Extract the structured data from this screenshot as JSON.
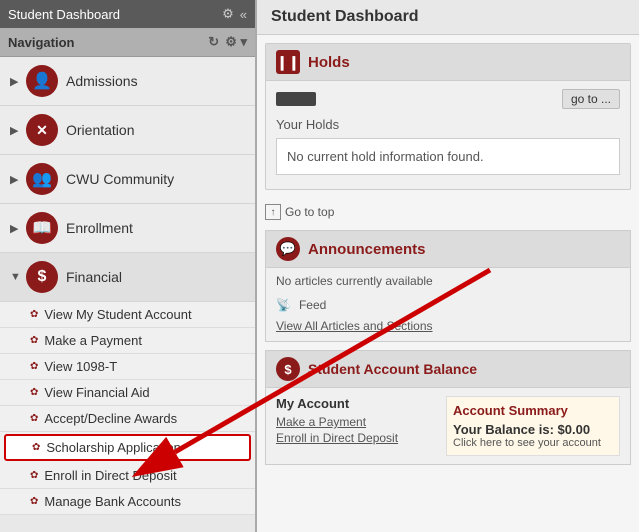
{
  "leftPanel": {
    "title": "Student Dashboard",
    "navLabel": "Navigation",
    "navItems": [
      {
        "id": "admissions",
        "label": "Admissions",
        "expanded": false,
        "icon": "person"
      },
      {
        "id": "orientation",
        "label": "Orientation",
        "expanded": false,
        "icon": "circle-x"
      },
      {
        "id": "cwu-community",
        "label": "CWU Community",
        "expanded": false,
        "icon": "people"
      },
      {
        "id": "enrollment",
        "label": "Enrollment",
        "expanded": false,
        "icon": "book"
      },
      {
        "id": "financial",
        "label": "Financial",
        "expanded": true,
        "icon": "dollar"
      }
    ],
    "financialSubItems": [
      {
        "id": "view-my-account",
        "label": "View My Student Account",
        "highlighted": false
      },
      {
        "id": "make-payment",
        "label": "Make a Payment",
        "highlighted": false
      },
      {
        "id": "view-1098t",
        "label": "View 1098-T",
        "highlighted": false
      },
      {
        "id": "view-financial-aid",
        "label": "View Financial Aid",
        "highlighted": false
      },
      {
        "id": "accept-decline-awards",
        "label": "Accept/Decline Awards",
        "highlighted": false
      },
      {
        "id": "scholarship-application",
        "label": "Scholarship Application",
        "highlighted": true
      },
      {
        "id": "enroll-direct-deposit",
        "label": "Enroll in Direct Deposit",
        "highlighted": false
      },
      {
        "id": "manage-bank-accounts",
        "label": "Manage Bank Accounts",
        "highlighted": false
      }
    ]
  },
  "rightPanel": {
    "title": "Student Dashboard",
    "holds": {
      "sectionTitle": "Holds",
      "yourHoldsLabel": "Your Holds",
      "noHoldsText": "No current hold information found.",
      "gotoLabel": "go to ...",
      "goToTopLabel": "Go to top"
    },
    "announcements": {
      "sectionTitle": "Announcements",
      "noArticlesText": "No articles currently available",
      "feedLabel": "Feed",
      "viewAllLabel": "View All Articles and Sections"
    },
    "accountBalance": {
      "sectionTitle": "Student Account Balance",
      "myAccountTitle": "My Account",
      "makePaymentLink": "Make a Payment",
      "enrollDirectLink": "Enroll in Direct Deposit",
      "summaryTitle": "Account Summary",
      "balanceText": "Your Balance is: $0.00",
      "clickHereText": "Click here to see your account"
    }
  }
}
